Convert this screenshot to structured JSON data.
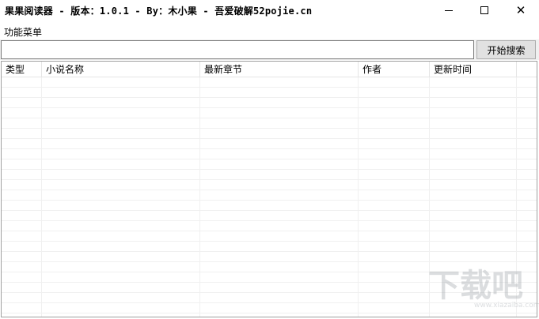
{
  "window": {
    "title": "果果阅读器 - 版本：1.0.1 - By：木小果 - 吾爱破解52pojie.cn",
    "controls": {
      "minimize_icon": "minimize-icon",
      "maximize_icon": "maximize-icon",
      "close_icon": "close-icon",
      "close_glyph": "✕"
    }
  },
  "menu": {
    "items": [
      {
        "label": "功能菜单"
      }
    ]
  },
  "search": {
    "value": "",
    "placeholder": "",
    "button_label": "开始搜索"
  },
  "table": {
    "columns": [
      {
        "label": "类型"
      },
      {
        "label": "小说名称"
      },
      {
        "label": "最新章节"
      },
      {
        "label": "作者"
      },
      {
        "label": "更新时间"
      }
    ],
    "rows": []
  },
  "watermark": {
    "logo_text": "下载吧",
    "url_text": "www.xiazaiba.com"
  }
}
